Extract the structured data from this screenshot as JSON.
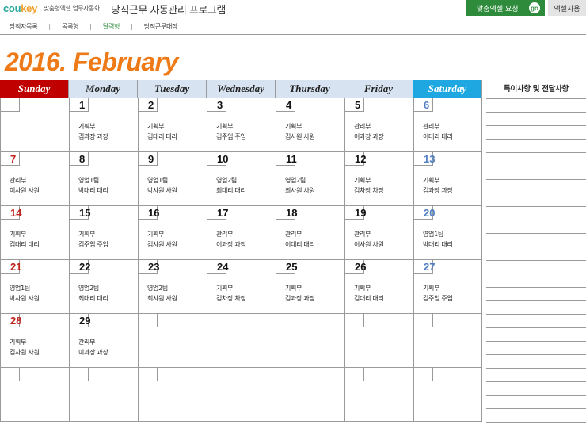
{
  "header": {
    "logo_part1": "cou",
    "logo_part2": "key",
    "logo_subtitle": "맞춤형엑셀 업무자동화",
    "app_title": "당직근무 자동관리 프로그램",
    "request_button": "맞춤엑셀 요청",
    "go_label": "go",
    "excel_use_button": "엑셀사용"
  },
  "tabs": [
    {
      "label": "당직자목록",
      "active": false
    },
    {
      "label": "목록형",
      "active": false
    },
    {
      "label": "달력형",
      "active": true
    },
    {
      "label": "당직근무대장",
      "active": false
    }
  ],
  "calendar": {
    "title": "2016. February",
    "weekdays": [
      "Sunday",
      "Monday",
      "Tuesday",
      "Wednesday",
      "Thursday",
      "Friday",
      "Saturday"
    ],
    "weeks": [
      [
        {
          "date": "",
          "dept": "",
          "person": ""
        },
        {
          "date": "1",
          "dept": "기획부",
          "person": "김과장 과장"
        },
        {
          "date": "2",
          "dept": "기획부",
          "person": "김대리 대리"
        },
        {
          "date": "3",
          "dept": "기획부",
          "person": "김주임 주임"
        },
        {
          "date": "4",
          "dept": "기획부",
          "person": "김사원 사원"
        },
        {
          "date": "5",
          "dept": "관리부",
          "person": "이과장 과장"
        },
        {
          "date": "6",
          "dept": "관리부",
          "person": "이대리 대리"
        }
      ],
      [
        {
          "date": "7",
          "dept": "관리부",
          "person": "이사원 사원"
        },
        {
          "date": "8",
          "dept": "영업1팀",
          "person": "박대리 대리"
        },
        {
          "date": "9",
          "dept": "영업1팀",
          "person": "박사원 사원"
        },
        {
          "date": "10",
          "dept": "영업2팀",
          "person": "최대리 대리"
        },
        {
          "date": "11",
          "dept": "영업2팀",
          "person": "최사원 사원"
        },
        {
          "date": "12",
          "dept": "기획부",
          "person": "김차장 차장"
        },
        {
          "date": "13",
          "dept": "기획부",
          "person": "김과장 과장"
        }
      ],
      [
        {
          "date": "14",
          "dept": "기획부",
          "person": "김대리 대리"
        },
        {
          "date": "15",
          "dept": "기획부",
          "person": "김주임 주임"
        },
        {
          "date": "16",
          "dept": "기획부",
          "person": "김사원 사원"
        },
        {
          "date": "17",
          "dept": "관리부",
          "person": "이과장 과장"
        },
        {
          "date": "18",
          "dept": "관리부",
          "person": "이대리 대리"
        },
        {
          "date": "19",
          "dept": "관리부",
          "person": "이사원 사원"
        },
        {
          "date": "20",
          "dept": "영업1팀",
          "person": "박대리 대리"
        }
      ],
      [
        {
          "date": "21",
          "dept": "영업1팀",
          "person": "박사원 사원"
        },
        {
          "date": "22",
          "dept": "영업2팀",
          "person": "최대리 대리"
        },
        {
          "date": "23",
          "dept": "영업2팀",
          "person": "최사원 사원"
        },
        {
          "date": "24",
          "dept": "기획부",
          "person": "김차장 차장"
        },
        {
          "date": "25",
          "dept": "기획부",
          "person": "김과장 과장"
        },
        {
          "date": "26",
          "dept": "기획부",
          "person": "김대리 대리"
        },
        {
          "date": "27",
          "dept": "기획부",
          "person": "김주임 주임"
        }
      ],
      [
        {
          "date": "28",
          "dept": "기획부",
          "person": "김사원 사원"
        },
        {
          "date": "29",
          "dept": "관리부",
          "person": "이과장 과장"
        },
        {
          "date": "",
          "dept": "",
          "person": ""
        },
        {
          "date": "",
          "dept": "",
          "person": ""
        },
        {
          "date": "",
          "dept": "",
          "person": ""
        },
        {
          "date": "",
          "dept": "",
          "person": ""
        },
        {
          "date": "",
          "dept": "",
          "person": ""
        }
      ],
      [
        {
          "date": "",
          "dept": "",
          "person": ""
        },
        {
          "date": "",
          "dept": "",
          "person": ""
        },
        {
          "date": "",
          "dept": "",
          "person": ""
        },
        {
          "date": "",
          "dept": "",
          "person": ""
        },
        {
          "date": "",
          "dept": "",
          "person": ""
        },
        {
          "date": "",
          "dept": "",
          "person": ""
        },
        {
          "date": "",
          "dept": "",
          "person": ""
        }
      ]
    ]
  },
  "notes": {
    "title": "특이사항 및 전달사항"
  },
  "colors": {
    "accent_orange": "#ee7a17",
    "sunday_red": "#c00000",
    "saturday_blue": "#1ea7e0",
    "button_green": "#2e8b3c"
  }
}
